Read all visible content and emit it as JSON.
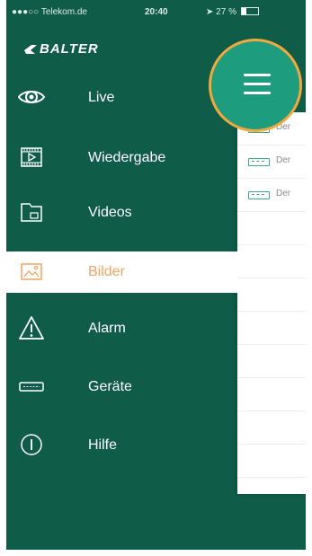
{
  "status_bar": {
    "carrier": "Telekom.de",
    "time": "20:40",
    "battery": "27 %",
    "battery_level": 0.27
  },
  "brand": {
    "name": "BALTER"
  },
  "menu": {
    "items": [
      {
        "label": "Live",
        "icon": "eye-icon"
      },
      {
        "label": "Wiedergabe",
        "icon": "film-icon"
      },
      {
        "label": "Videos",
        "icon": "folder-icon"
      },
      {
        "label": "Bilder",
        "icon": "image-icon",
        "active": true
      },
      {
        "label": "Alarm",
        "icon": "warning-icon"
      },
      {
        "label": "Geräte",
        "icon": "device-icon"
      },
      {
        "label": "Hilfe",
        "icon": "info-icon"
      }
    ]
  },
  "content_preview": {
    "rows": [
      {
        "text": "Der"
      },
      {
        "text": "Der"
      },
      {
        "text": "Der"
      }
    ]
  },
  "colors": {
    "sidebar": "#0f5c49",
    "accent": "#f2a35e",
    "hamburger": "#1e9c7e",
    "highlight_ring": "#f3a83d"
  }
}
